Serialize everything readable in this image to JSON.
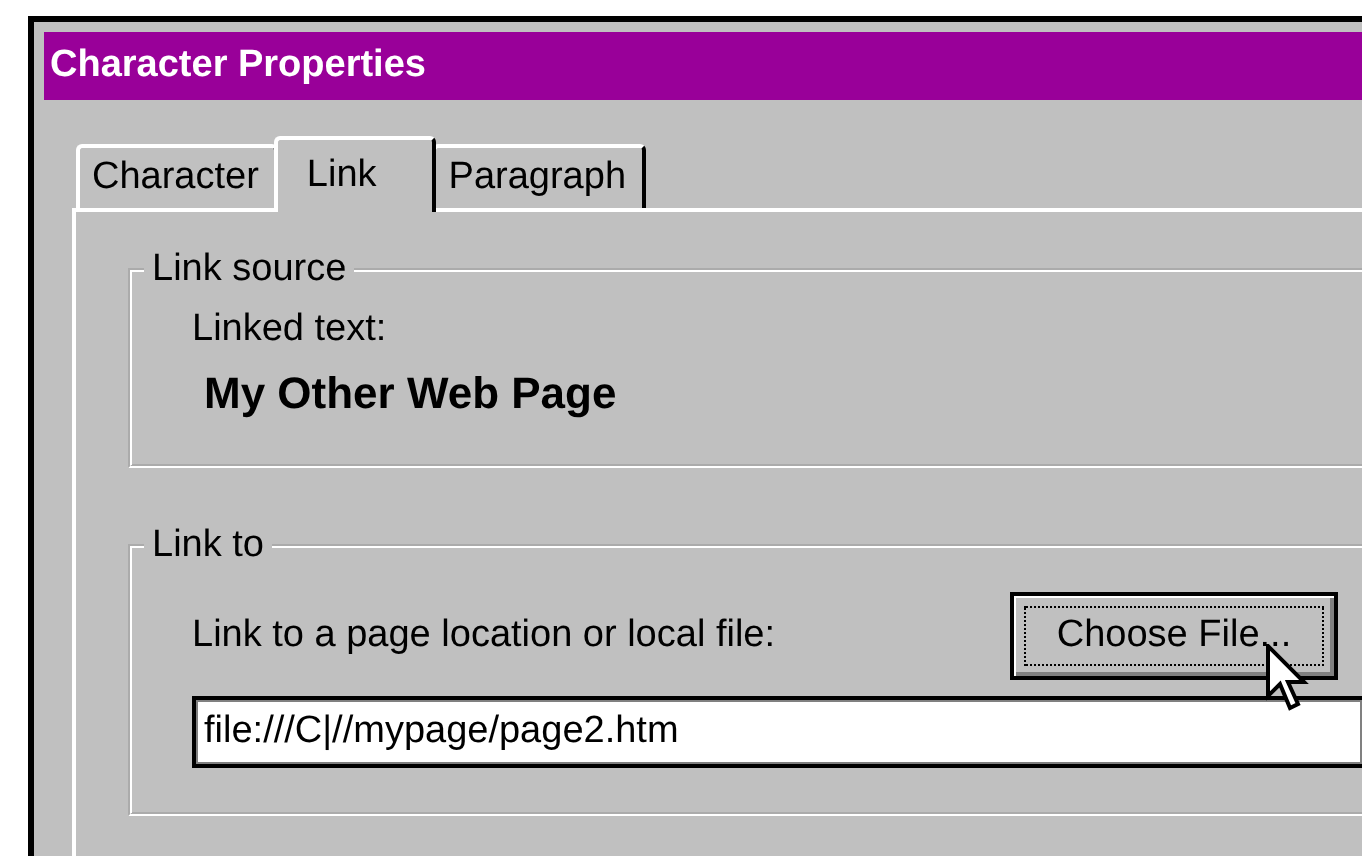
{
  "window": {
    "title": "Character Properties"
  },
  "tabs": [
    {
      "label": "Character",
      "selected": false
    },
    {
      "label": "Link",
      "selected": true
    },
    {
      "label": "Paragraph",
      "selected": false
    }
  ],
  "link_source": {
    "legend": "Link source",
    "label": "Linked text:",
    "value": "My Other Web Page"
  },
  "link_to": {
    "legend": "Link to",
    "label": "Link to a page location or local file:",
    "button": "Choose File...",
    "field_value": "file:///C|//mypage/page2.htm"
  }
}
